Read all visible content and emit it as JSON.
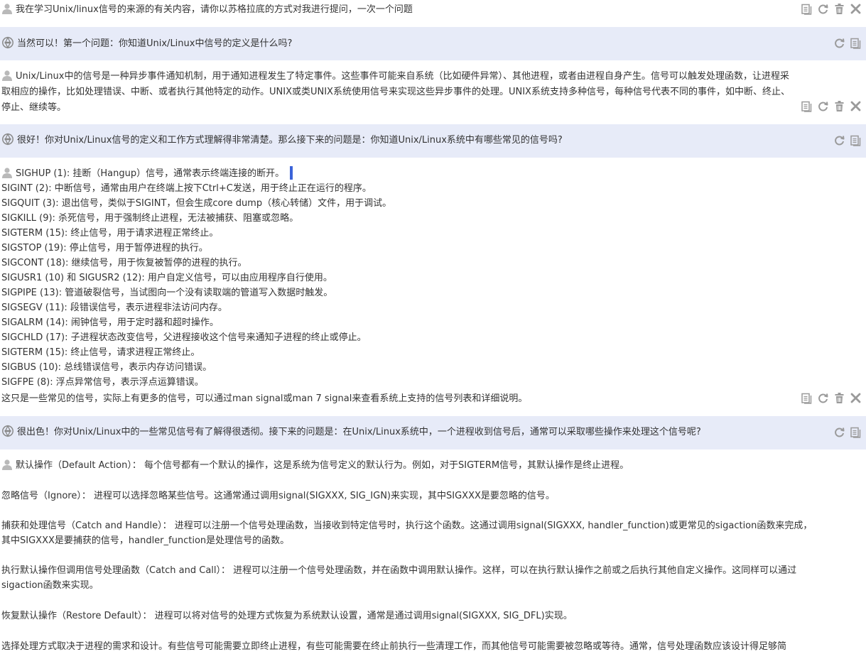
{
  "messages": {
    "m1": {
      "text": "我在学习Unix/linux信号的来源的有关内容，请你以苏格拉底的方式对我进行提问，一次一个问题"
    },
    "m2": {
      "text": "当然可以！第一个问题：你知道Unix/Linux中信号的定义是什么吗?"
    },
    "m3": {
      "lines": [
        "Unix/Linux中的信号是一种异步事件通知机制，用于通知进程发生了特定事件。这些事件可能来自系统（比如硬件异常）、其他进程，或者由进程自身产生。信号可以触发处理函数，让进程采",
        "取相应的操作，比如处理错误、中断、或者执行其他特定的动作。UNIX或类UNIX系统使用信号来实现这些异步事件的处理。UNIX系统支持多种信号，每种信号代表不同的事件，如中断、终止、",
        "停止、继续等。"
      ]
    },
    "m4": {
      "text": "很好！你对Unix/Linux信号的定义和工作方式理解得非常清楚。那么接下来的问题是：你知道Unix/Linux系统中有哪些常见的信号吗?"
    },
    "m5": {
      "lines": [
        "SIGHUP (1): 挂断（Hangup）信号，通常表示终端连接的断开。",
        "SIGINT (2): 中断信号，通常由用户在终端上按下Ctrl+C发送，用于终止正在运行的程序。",
        "SIGQUIT (3): 退出信号，类似于SIGINT，但会生成core dump（核心转储）文件，用于调试。",
        "SIGKILL (9): 杀死信号，用于强制终止进程，无法被捕获、阻塞或忽略。",
        "SIGTERM (15): 终止信号，用于请求进程正常终止。",
        "SIGSTOP (19): 停止信号，用于暂停进程的执行。",
        "SIGCONT (18): 继续信号，用于恢复被暂停的进程的执行。",
        "SIGUSR1 (10) 和 SIGUSR2 (12): 用户自定义信号，可以由应用程序自行使用。",
        "SIGPIPE (13): 管道破裂信号，当试图向一个没有读取端的管道写入数据时触发。",
        "SIGSEGV (11): 段错误信号，表示进程非法访问内存。",
        "SIGALRM (14): 闹钟信号，用于定时器和超时操作。",
        "SIGCHLD (17): 子进程状态改变信号，父进程接收这个信号来通知子进程的终止或停止。",
        "SIGTERM (15): 终止信号，请求进程正常终止。",
        "SIGBUS (10): 总线错误信号，表示内存访问错误。",
        "SIGFPE (8): 浮点异常信号，表示浮点运算错误。",
        "这只是一些常见的信号，实际上有更多的信号，可以通过man signal或man 7 signal来查看系统上支持的信号列表和详细说明。"
      ]
    },
    "m6": {
      "text": "很出色！你对Unix/Linux中的一些常见信号有了解得很透彻。接下来的问题是：在Unix/Linux系统中，一个进程收到信号后，通常可以采取哪些操作来处理这个信号呢?"
    },
    "m7": {
      "lines": [
        "默认操作（Default Action）： 每个信号都有一个默认的操作，这是系统为信号定义的默认行为。例如，对于SIGTERM信号，其默认操作是终止进程。",
        "忽略信号（Ignore）： 进程可以选择忽略某些信号。这通常通过调用signal(SIGXXX, SIG_IGN)来实现，其中SIGXXX是要忽略的信号。",
        "捕获和处理信号（Catch and Handle）： 进程可以注册一个信号处理函数，当接收到特定信号时，执行这个函数。这通过调用signal(SIGXXX, handler_function)或更常见的sigaction函数来完成，",
        "其中SIGXXX是要捕获的信号，handler_function是处理信号的函数。",
        "执行默认操作但调用信号处理函数（Catch and Call）： 进程可以注册一个信号处理函数，并在函数中调用默认操作。这样，可以在执行默认操作之前或之后执行其他自定义操作。这同样可以通过",
        "sigaction函数来实现。",
        "恢复默认操作（Restore Default）： 进程可以将对信号的处理方式恢复为系统默认设置，通常是通过调用signal(SIGXXX, SIG_DFL)实现。",
        "选择处理方式取决于进程的需求和设计。有些信号可能需要立即终止进程，有些可能需要在终止前执行一些清理工作，而其他信号可能需要被忽略或等待。通常，信号处理函数应该设计得足够简"
      ]
    }
  }
}
